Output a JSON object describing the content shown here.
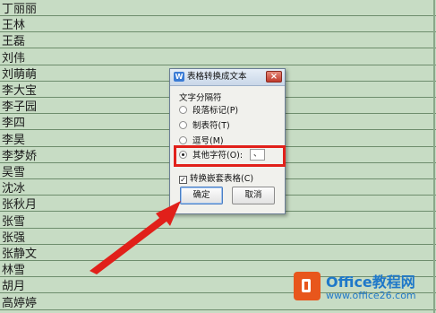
{
  "sheet": {
    "names": [
      "丁丽丽",
      "王林",
      "王磊",
      "刘伟",
      "刘萌萌",
      "李大宝",
      "李子园",
      "李四",
      "李昊",
      "李梦娇",
      "吴雪",
      "沈冰",
      "张秋月",
      "张雪",
      "张强",
      "张静文",
      "林雪",
      "胡月",
      "高婷婷"
    ]
  },
  "dialog": {
    "title": "表格转换成文本",
    "group_label": "文字分隔符",
    "options": {
      "paragraph": "段落标记(P)",
      "tab": "制表符(T)",
      "comma": "逗号(M)",
      "other": "其他字符(O):"
    },
    "selected": "other",
    "other_char": "、",
    "nested_tables_label": "转换嵌套表格(C)",
    "nested_tables_checked": true,
    "ok_label": "确定",
    "cancel_label": "取消",
    "close_glyph": "×",
    "app_icon_glyph": "W"
  },
  "watermark": {
    "name": "Office教程网",
    "url": "www.office26.com"
  },
  "colors": {
    "sheet_bg": "#c7dcc4",
    "highlight": "#e1201a",
    "brand_orange": "#e8561c",
    "brand_blue": "#1f78c9"
  },
  "icons": {
    "app_icon": "wps-writer-icon",
    "close": "close-icon",
    "logo": "office-logo-icon"
  }
}
